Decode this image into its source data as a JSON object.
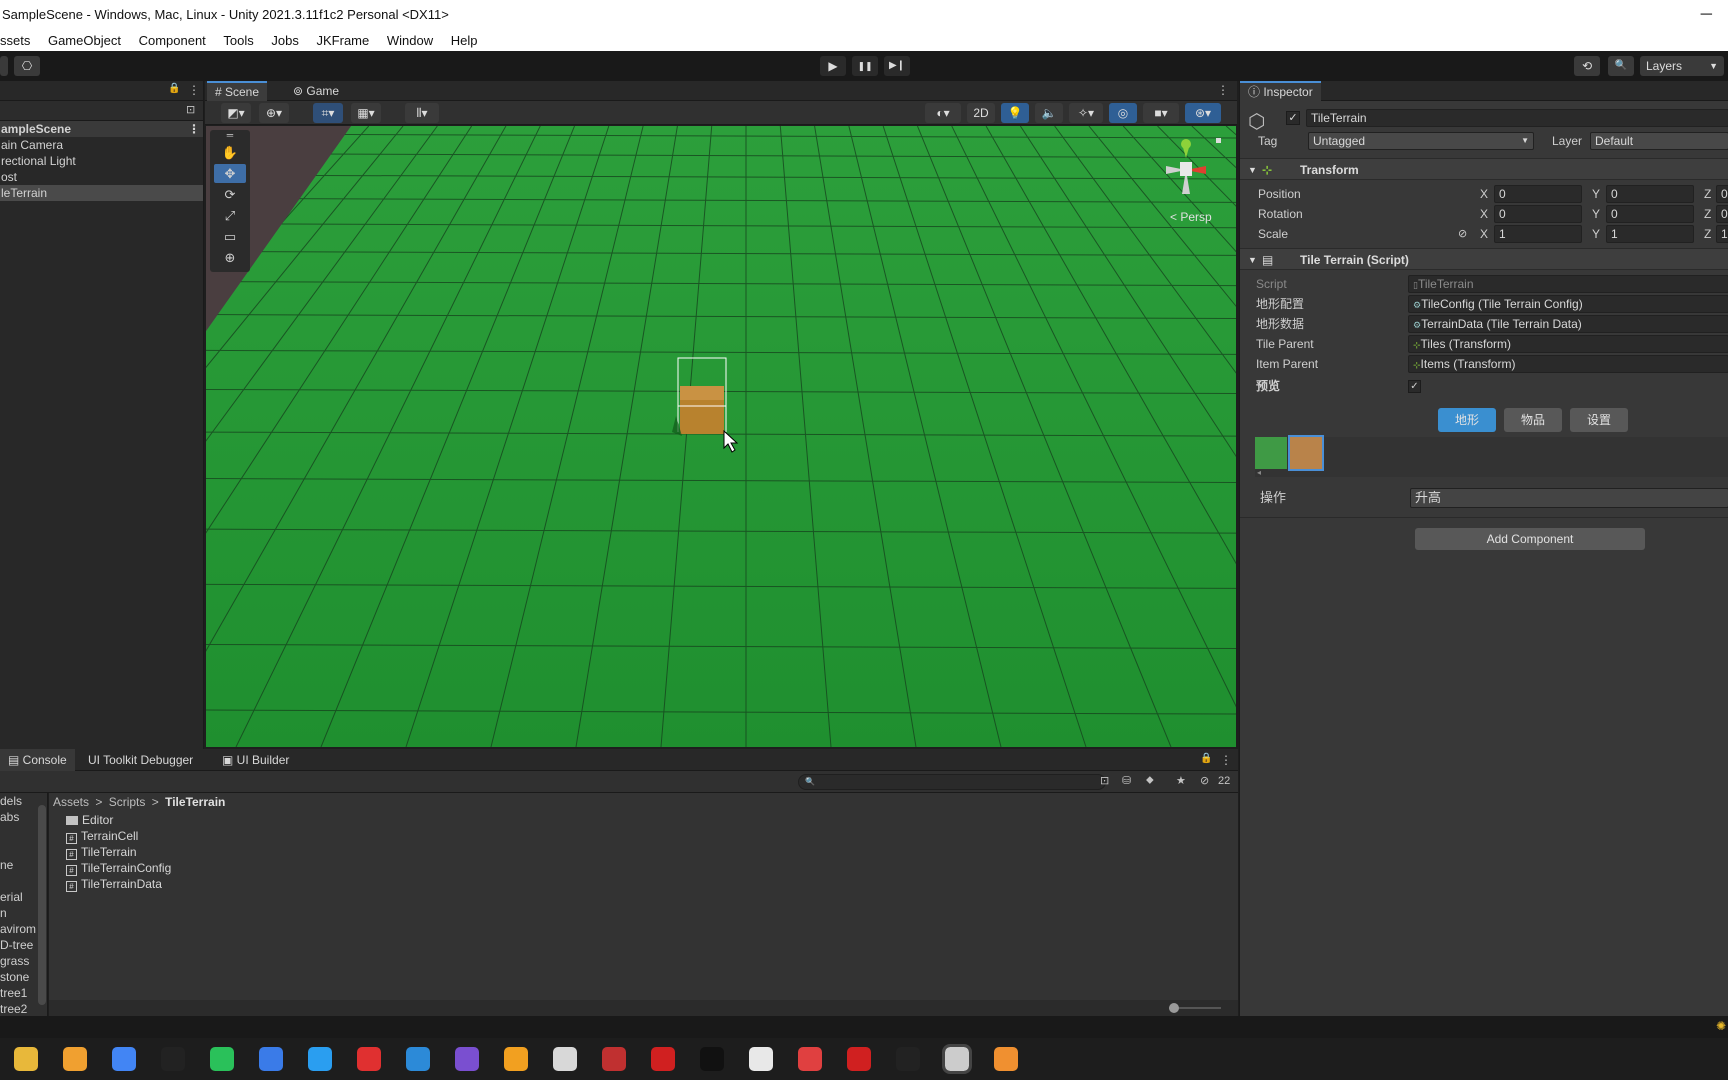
{
  "window": {
    "title": "SampleScene - Windows, Mac, Linux - Unity 2021.3.11f1c2 Personal <DX11>",
    "minimize": "─"
  },
  "menu": [
    "ssets",
    "GameObject",
    "Component",
    "Tools",
    "Jobs",
    "JKFrame",
    "Window",
    "Help"
  ],
  "toolbar": {
    "play": "▶",
    "pause": "❚❚",
    "step": "▶❙",
    "history": "⟲",
    "search": "🔍",
    "layers": "Layers"
  },
  "hierarchy": {
    "scene": "ampleScene",
    "items": [
      {
        "label": "ain Camera",
        "selected": false
      },
      {
        "label": "rectional Light",
        "selected": false
      },
      {
        "label": "ost",
        "selected": false
      },
      {
        "label": "leTerrain",
        "selected": true
      }
    ]
  },
  "scene_view": {
    "tabs": [
      {
        "label": "# Scene",
        "active": true
      },
      {
        "label": "⊚ Game",
        "active": false
      }
    ],
    "mode_2d": "2D",
    "gizmo_label": "< Persp",
    "tools": [
      "✋",
      "✥",
      "⟳",
      "⤢",
      "▭",
      "⊕"
    ],
    "active_tool": 1
  },
  "inspector": {
    "tab": "Inspector",
    "object_name": "TileTerrain",
    "tag_label": "Tag",
    "tag_value": "Untagged",
    "layer_label": "Layer",
    "layer_value": "Default",
    "transform": {
      "title": "Transform",
      "rows": [
        {
          "label": "Position",
          "x": "0",
          "y": "0",
          "z": "0"
        },
        {
          "label": "Rotation",
          "x": "0",
          "y": "0",
          "z": "0"
        },
        {
          "label": "Scale",
          "x": "1",
          "y": "1",
          "z": "1"
        }
      ],
      "axis_x": "X",
      "axis_y": "Y",
      "axis_z": "Z"
    },
    "script_component": {
      "title": "Tile Terrain (Script)",
      "fields": [
        {
          "label": "Script",
          "value": "TileTerrain",
          "disabled": true
        },
        {
          "label": "地形配置",
          "value": "TileConfig (Tile Terrain Config)"
        },
        {
          "label": "地形数据",
          "value": "TerrainData (Tile Terrain Data)"
        },
        {
          "label": "Tile Parent",
          "value": "Tiles (Transform)"
        },
        {
          "label": "Item Parent",
          "value": "Items (Transform)"
        }
      ],
      "preview_label": "预览",
      "preview_check": "✓",
      "segments": [
        {
          "label": "地形",
          "active": true
        },
        {
          "label": "物品",
          "active": false
        },
        {
          "label": "设置",
          "active": false
        }
      ],
      "swatches": [
        "#3f9a45",
        "#b9834a"
      ],
      "operation_label": "操作",
      "operation_value": "升高"
    },
    "add_component": "Add Component"
  },
  "project": {
    "tabs": [
      "Console",
      "UI Toolkit Debugger",
      "UI Builder"
    ],
    "lock_icon": "🔒",
    "hidden_count": "22",
    "breadcrumb": [
      "Assets",
      "Scripts",
      "TileTerrain"
    ],
    "breadcrumb_sep": ">",
    "left_items": [
      "dels",
      "abs",
      "",
      "",
      "ne",
      "",
      "erial",
      "n",
      "avirom",
      "D-tree",
      "grass",
      "stone",
      "tree1",
      "tree2"
    ],
    "assets": [
      {
        "name": "Editor",
        "type": "folder"
      },
      {
        "name": "TerrainCell",
        "type": "script"
      },
      {
        "name": "TileTerrain",
        "type": "script"
      },
      {
        "name": "TileTerrainConfig",
        "type": "script"
      },
      {
        "name": "TileTerrainData",
        "type": "script"
      }
    ],
    "slider_value": 0
  },
  "colors": {
    "accent": "#3e6ea7",
    "segment_active": "#3a8fd0",
    "grass": "#2a9a3a",
    "block": "#b8822e"
  },
  "taskbar_icons": [
    "file-explorer",
    "browser-yellow",
    "chrome",
    "record",
    "wechat",
    "pen-app",
    "app-blue",
    "app-red",
    "vscode",
    "visual-studio",
    "app-colorful",
    "unity",
    "app-red-m",
    "wps",
    "qq",
    "chat",
    "app-red-2",
    "wps-2",
    "obs",
    "unity-active",
    "app-orange"
  ]
}
